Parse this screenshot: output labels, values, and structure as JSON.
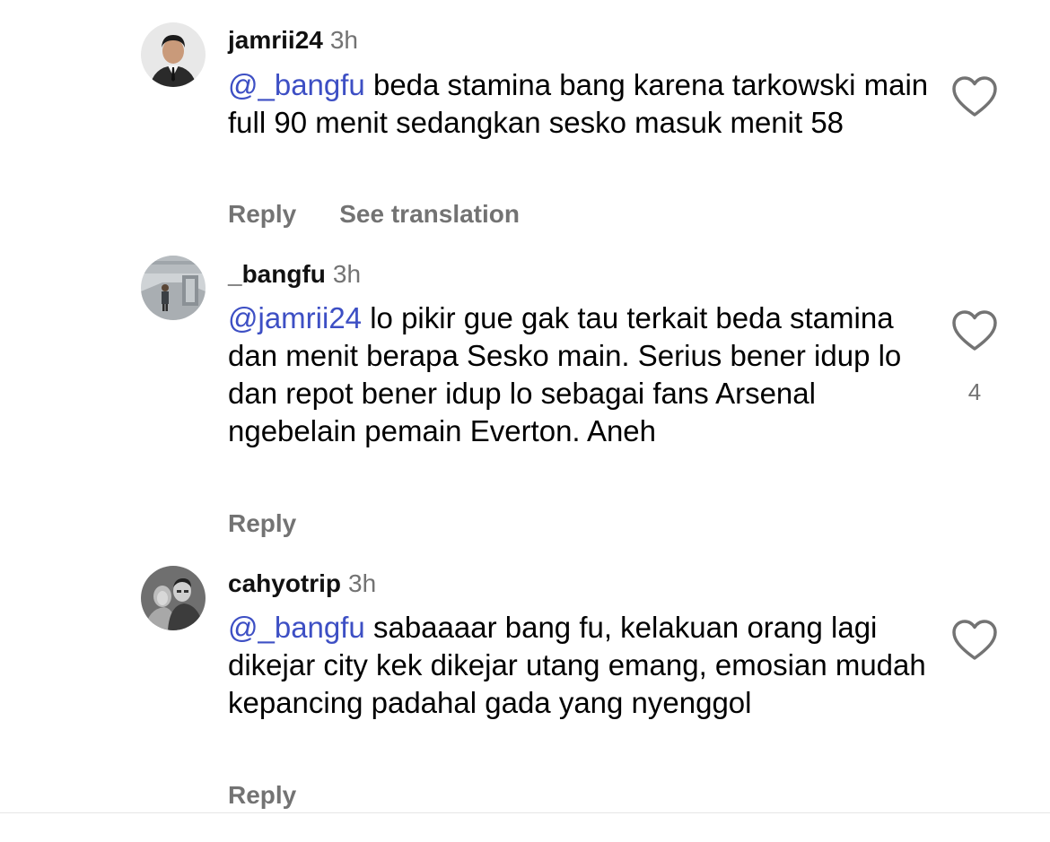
{
  "comments": [
    {
      "username": "jamrii24",
      "time": "3h",
      "mention": "@_bangfu",
      "text": " beda stamina bang karena tarkowski main full 90 menit sedangkan sesko masuk menit 58",
      "reply_label": "Reply",
      "translation_label": "See translation",
      "like_icon": "heart-outline-icon"
    },
    {
      "username": "_bangfu",
      "time": "3h",
      "mention": "@jamrii24",
      "text": " lo pikir gue gak tau terkait beda stamina dan menit berapa Sesko main. Serius bener idup lo dan repot bener idup lo sebagai fans Arsenal ngebelain pemain Everton. Aneh",
      "reply_label": "Reply",
      "like_count": "4",
      "like_icon": "heart-outline-icon"
    },
    {
      "username": "cahyotrip",
      "time": "3h",
      "mention": "@_bangfu",
      "text": " sabaaaar bang fu, kelakuan orang lagi dikejar city kek dikejar utang emang, emosian mudah kepancing padahal gada yang nyenggol",
      "reply_label": "Reply",
      "like_icon": "heart-outline-icon"
    }
  ],
  "colors": {
    "mention": "#3d4fc4",
    "secondary_text": "#737373",
    "primary_text": "#000000"
  }
}
